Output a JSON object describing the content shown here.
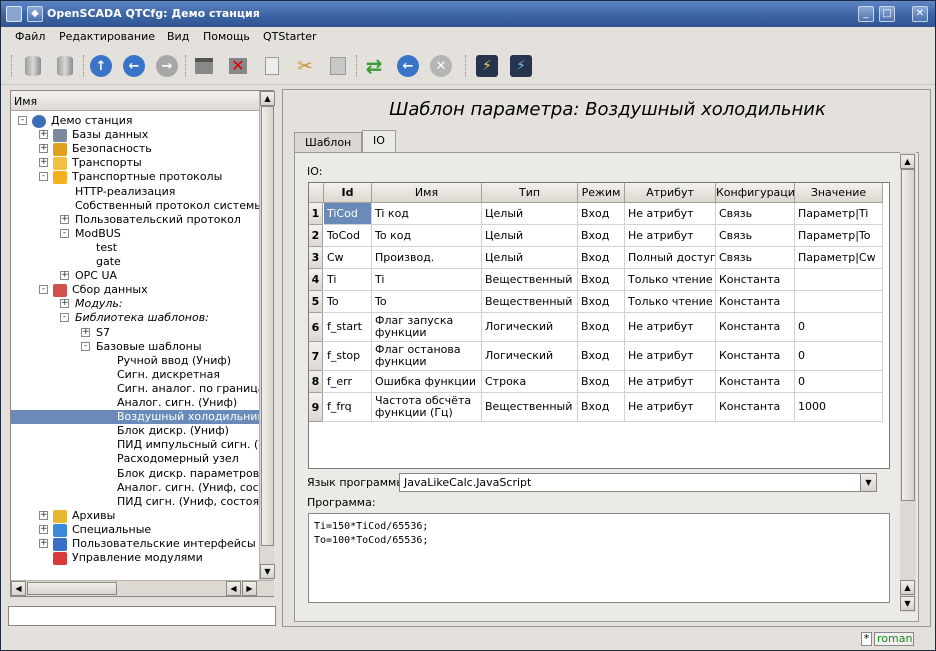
{
  "window": {
    "title": "OpenSCADA QTCfg: Демо станция"
  },
  "menu": [
    "Файл",
    "Редактирование",
    "Вид",
    "Помощь",
    "QTStarter"
  ],
  "toolbar_icons": [
    "db-load-icon",
    "db-save-icon",
    "up-icon",
    "back-icon",
    "forward-icon",
    "add-item-icon",
    "delete-item-icon",
    "copy-icon",
    "cut-icon",
    "paste-icon",
    "refresh-icon",
    "start-icon",
    "stop-icon",
    "connect-icon",
    "disconnect-icon"
  ],
  "tree": {
    "header": "Имя",
    "items": [
      {
        "label": "Демо станция",
        "level": 0,
        "exp": "-",
        "icon": "station"
      },
      {
        "label": "Базы данных",
        "level": 1,
        "exp": "+",
        "icon": "db"
      },
      {
        "label": "Безопасность",
        "level": 1,
        "exp": "+",
        "icon": "security"
      },
      {
        "label": "Транспорты",
        "level": 1,
        "exp": "+",
        "icon": "transport"
      },
      {
        "label": "Транспортные протоколы",
        "level": 1,
        "exp": "-",
        "icon": "folder"
      },
      {
        "label": "HTTP-реализация",
        "level": 2,
        "exp": "",
        "icon": ""
      },
      {
        "label": "Собственный протокол системы OpenSCADA",
        "level": 2,
        "exp": "",
        "icon": ""
      },
      {
        "label": "Пользовательский протокол",
        "level": 2,
        "exp": "+",
        "icon": ""
      },
      {
        "label": "ModBUS",
        "level": 2,
        "exp": "-",
        "icon": ""
      },
      {
        "label": "test",
        "level": 3,
        "exp": "",
        "icon": ""
      },
      {
        "label": "gate",
        "level": 3,
        "exp": "",
        "icon": ""
      },
      {
        "label": "OPC UA",
        "level": 2,
        "exp": "+",
        "icon": ""
      },
      {
        "label": "Сбор данных",
        "level": 1,
        "exp": "-",
        "icon": "daq"
      },
      {
        "label": "Модуль:",
        "level": 2,
        "exp": "+",
        "icon": "",
        "italic": true
      },
      {
        "label": "Библиотека шаблонов:",
        "level": 2,
        "exp": "-",
        "icon": "",
        "italic": true
      },
      {
        "label": "S7",
        "level": 3,
        "exp": "+",
        "icon": ""
      },
      {
        "label": "Базовые шаблоны",
        "level": 3,
        "exp": "-",
        "icon": ""
      },
      {
        "label": "Ручной ввод (Униф)",
        "level": 4,
        "exp": "",
        "icon": ""
      },
      {
        "label": "Сигн. дискретная",
        "level": 4,
        "exp": "",
        "icon": ""
      },
      {
        "label": "Сигн. аналог. по границам",
        "level": 4,
        "exp": "",
        "icon": ""
      },
      {
        "label": "Аналог. сигн. (Униф)",
        "level": 4,
        "exp": "",
        "icon": ""
      },
      {
        "label": "Воздушный холодильник",
        "level": 4,
        "exp": "",
        "icon": "",
        "selected": true
      },
      {
        "label": "Блок дискр. (Униф)",
        "level": 4,
        "exp": "",
        "icon": ""
      },
      {
        "label": "ПИД импульсный сигн. (Униф)",
        "level": 4,
        "exp": "",
        "icon": ""
      },
      {
        "label": "Расходомерный узел",
        "level": 4,
        "exp": "",
        "icon": ""
      },
      {
        "label": "Блок дискр. параметров",
        "level": 4,
        "exp": "",
        "icon": ""
      },
      {
        "label": "Аналог. сигн. (Униф, состояние)",
        "level": 4,
        "exp": "",
        "icon": ""
      },
      {
        "label": "ПИД сигн. (Униф, состояние)",
        "level": 4,
        "exp": "",
        "icon": ""
      },
      {
        "label": "Архивы",
        "level": 1,
        "exp": "+",
        "icon": "archive"
      },
      {
        "label": "Специальные",
        "level": 1,
        "exp": "+",
        "icon": "special"
      },
      {
        "label": "Пользовательские интерфейсы",
        "level": 1,
        "exp": "+",
        "icon": "ui"
      },
      {
        "label": "Управление модулями",
        "level": 1,
        "exp": "",
        "icon": "modules"
      }
    ]
  },
  "page": {
    "title": "Шаблон параметра: Воздушный холодильник",
    "tabs": [
      "Шаблон",
      "IO"
    ],
    "active_tab": "IO",
    "io_label": "IO:",
    "columns": [
      "Id",
      "Имя",
      "Тип",
      "Режим",
      "Атрибут",
      "Конфигурация",
      "Значение"
    ],
    "rows": [
      [
        "TiCod",
        "Ti код",
        "Целый",
        "Вход",
        "Не атрибут",
        "Связь",
        "Параметр|Ti"
      ],
      [
        "ToCod",
        "To код",
        "Целый",
        "Вход",
        "Не атрибут",
        "Связь",
        "Параметр|To"
      ],
      [
        "Cw",
        "Производ.",
        "Целый",
        "Вход",
        "Полный доступ",
        "Связь",
        "Параметр|Cw"
      ],
      [
        "Ti",
        "Ti",
        "Вещественный",
        "Вход",
        "Только чтение",
        "Константа",
        ""
      ],
      [
        "To",
        "To",
        "Вещественный",
        "Вход",
        "Только чтение",
        "Константа",
        ""
      ],
      [
        "f_start",
        "Флаг запуска функции",
        "Логический",
        "Вход",
        "Не атрибут",
        "Константа",
        "0"
      ],
      [
        "f_stop",
        "Флаг останова функции",
        "Логический",
        "Вход",
        "Не атрибут",
        "Константа",
        "0"
      ],
      [
        "f_err",
        "Ошибка функции",
        "Строка",
        "Вход",
        "Не атрибут",
        "Константа",
        "0"
      ],
      [
        "f_frq",
        "Частота обсчёта функции (Гц)",
        "Вещественный",
        "Вход",
        "Не атрибут",
        "Константа",
        "1000"
      ]
    ],
    "lang_label": "Язык программы:",
    "lang_value": "JavaLikeCalc.JavaScript",
    "program_label": "Программа:",
    "program_text": "Ti=150*TiCod/65536;\nTo=100*ToCod/65536;"
  },
  "status": {
    "modified": "*",
    "user": "roman"
  },
  "colors": {
    "selection": "#6a8bb9",
    "titlebar": "#3c63a3",
    "window_bg": "#e4e1dc"
  }
}
